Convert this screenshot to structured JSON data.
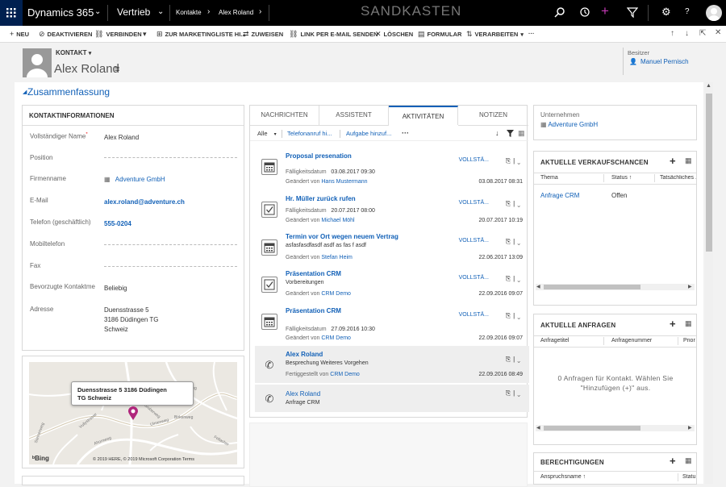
{
  "topbar": {
    "app_name": "Dynamics 365",
    "area": "Vertrieb",
    "breadcrumb_1": "Kontakte",
    "breadcrumb_2": "Alex Roland",
    "environment": "SANDKASTEN"
  },
  "commands": [
    {
      "icon": "+",
      "label": "NEU"
    },
    {
      "icon": "⊘",
      "label": "DEAKTIVIEREN"
    },
    {
      "icon": "⛓",
      "label": "VERBINDEN"
    },
    {
      "icon": "▾",
      "label": ""
    },
    {
      "icon": "⊞",
      "label": "ZUR MARKETINGLISTE HI..."
    },
    {
      "icon": "⇄",
      "label": "ZUWEISEN"
    },
    {
      "icon": "⛓",
      "label": "LINK PER E-MAIL SENDEN"
    },
    {
      "icon": "✕",
      "label": "LÖSCHEN"
    },
    {
      "icon": "▤",
      "label": "FORMULAR"
    },
    {
      "icon": "⇅",
      "label": "VERARBEITEN"
    },
    {
      "icon": "",
      "label": "···"
    }
  ],
  "header": {
    "entity": "KONTAKT",
    "name": "Alex Roland",
    "owner_label": "Besitzer",
    "owner": "Manuel Pernisch"
  },
  "summary_title": "Zusammenfassung",
  "contact_info": {
    "title": "KONTAKTINFORMATIONEN",
    "fields": [
      {
        "label": "Vollständiger Name",
        "value": "Alex Roland"
      },
      {
        "label": "Position",
        "value": ""
      },
      {
        "label": "Firmenname",
        "value": "Adventure GmbH"
      },
      {
        "label": "E-Mail",
        "value": "alex.roland@adventure.ch"
      },
      {
        "label": "Telefon (geschäftlich)",
        "value": "555-0204"
      },
      {
        "label": "Mobiltelefon",
        "value": ""
      },
      {
        "label": "Fax",
        "value": ""
      },
      {
        "label": "Bevorzugte Kontaktme",
        "value": "Beliebig"
      },
      {
        "label": "Adresse",
        "value_lines": [
          "Duensstrasse 5",
          "3186 Düdingen TG",
          "Schweiz"
        ]
      }
    ],
    "required_marker": "*"
  },
  "map": {
    "callout_line1": "Duensstrasse 5 3186 Düdingen",
    "callout_line2": "TG Schweiz",
    "brand": "Bing",
    "copyright": "© 2019 HERE, © 2019 Microsoft Corporation Terms",
    "streets": [
      "Vullystrasse",
      "Ulmenweg",
      "Birkenweg",
      "Ahornweg",
      "Gruberweg",
      "Sonnenweg",
      "Mühleweg",
      "Fellacher"
    ]
  },
  "tabs": [
    "NACHRICHTEN",
    "ASSISTENT",
    "AKTIVITÄTEN",
    "NOTIZEN"
  ],
  "activity_toolbar": {
    "filter": "Alle",
    "phone": "Telefonanruf hi...",
    "task": "Aufgabe hinzuf...",
    "more": "···"
  },
  "activities": [
    {
      "icon": "calendar",
      "title": "Proposal presenation",
      "status": "VOLLSTÄ...",
      "line1": "Fälligkeitsdatum",
      "line1_value": "03.08.2017 09:30",
      "line2_label": "Geändert von",
      "line2_value": "Hans Mustermann",
      "date": "03.08.2017 08:31"
    },
    {
      "icon": "task",
      "title": "Hr. Müller zurück rufen",
      "status": "VOLLSTÄ...",
      "line1": "Fälligkeitsdatum",
      "line1_value": "20.07.2017 08:00",
      "line2_label": "Geändert von",
      "line2_value": "Michael Möhl",
      "date": "20.07.2017 10:19"
    },
    {
      "icon": "calendar",
      "title": "Termin vor Ort wegen neuem Vertrag",
      "status": "VOLLSTÄ...",
      "line1": "asfasfasdfasdf asdf as fas f asdf",
      "line1_value": "",
      "line2_label": "Geändert von",
      "line2_value": "Stefan Heim",
      "date": "22.06.2017 13:09"
    },
    {
      "icon": "task",
      "title": "Präsentation CRM",
      "status": "VOLLSTÄ...",
      "line1": "Vorbereitungen",
      "line1_value": "",
      "line2_label": "Geändert von",
      "line2_value": "CRM Demo",
      "date": "22.09.2016 09:07"
    },
    {
      "icon": "calendar",
      "title": "Präsentation CRM",
      "status": "VOLLSTÄ...",
      "line1": "Fälligkeitsdatum",
      "line1_value": "27.09.2016 10:30",
      "line2_label": "Geändert von",
      "line2_value": "CRM Demo",
      "date": "22.09.2016 09:07"
    },
    {
      "icon": "phone",
      "title": "Alex Roland",
      "status": "",
      "line1": "Besprechung Weiteres Vorgehen",
      "line1_value": "",
      "line2_label": "Fertiggestellt von",
      "line2_value": "CRM Demo",
      "date": "22.09.2016 08:49"
    },
    {
      "icon": "phone",
      "title": "Alex Roland",
      "status": "",
      "line1": "Anfrage CRM",
      "line1_value": "",
      "line2_label": "",
      "line2_value": "",
      "date": ""
    }
  ],
  "company": {
    "label": "Unternehmen",
    "value": "Adventure GmbH"
  },
  "opportunities": {
    "title": "AKTUELLE VERKAUFSCHANCEN",
    "columns": [
      "Thema",
      "Status ↑",
      "Tatsächliches ..."
    ],
    "rows": [
      {
        "topic": "Anfrage CRM",
        "status": "Offen"
      }
    ]
  },
  "cases": {
    "title": "AKTUELLE ANFRAGEN",
    "columns": [
      "Anfragetitel",
      "Anfragenummer",
      "Prior"
    ],
    "empty": "0 Anfragen für Kontakt. Wählen Sie \"Hinzufügen (+)\" aus."
  },
  "permissions": {
    "title": "BERECHTIGUNGEN",
    "columns": [
      "Anspruchsname ↑",
      "Statu"
    ]
  },
  "colors": {
    "accent": "#1160b7",
    "topbar": "#000000",
    "active_tab": "#1160b7"
  }
}
